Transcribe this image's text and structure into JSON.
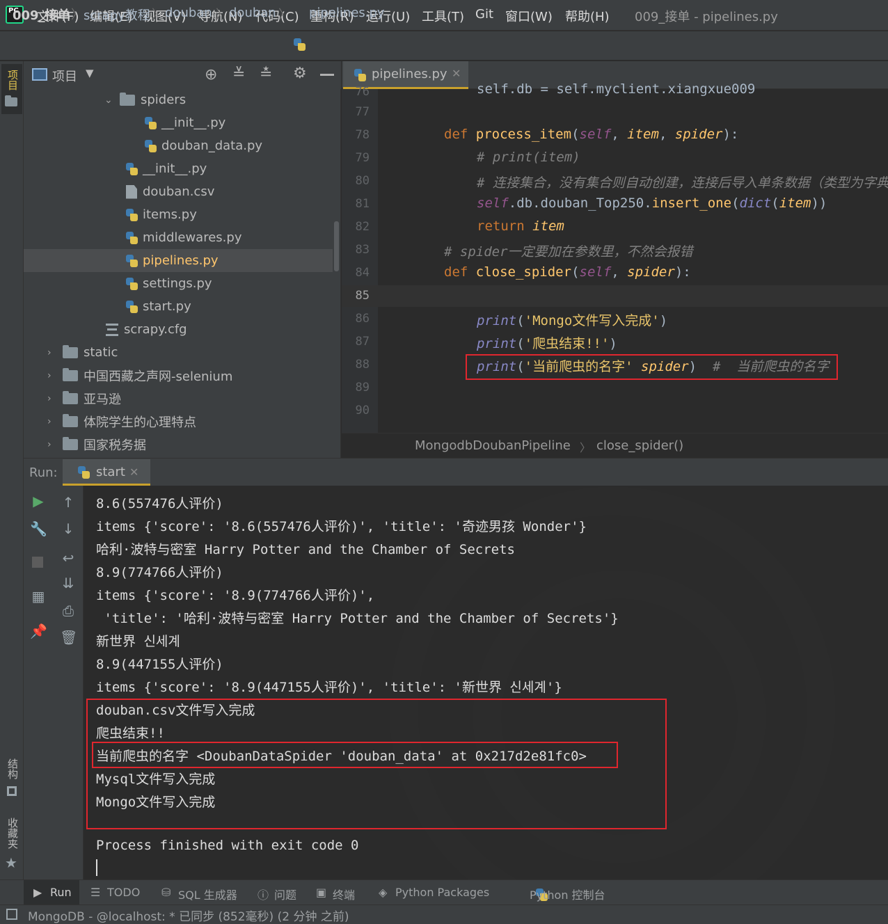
{
  "menubar": {
    "logo": "PC",
    "items": [
      "文件(F)",
      "编辑(E)",
      "视图(V)",
      "导航(N)",
      "代码(C)",
      "重构(R)",
      "运行(U)",
      "工具(T)",
      "Git",
      "窗口(W)",
      "帮助(H)"
    ],
    "window_title": "009_接单 - pipelines.py"
  },
  "breadcrumb": [
    "009_接单",
    "scrapy教程",
    "douban",
    "douban",
    "pipelines.py"
  ],
  "left_strip": {
    "project_label": "项目",
    "structure_label": "结构",
    "favorites_label": "收藏夹"
  },
  "project": {
    "title": "项目",
    "tree": [
      {
        "label": "spiders",
        "type": "folder",
        "expanded": true
      },
      {
        "label": "__init__.py",
        "type": "py"
      },
      {
        "label": "douban_data.py",
        "type": "py"
      },
      {
        "label": "__init__.py",
        "type": "py"
      },
      {
        "label": "douban.csv",
        "type": "file"
      },
      {
        "label": "items.py",
        "type": "py"
      },
      {
        "label": "middlewares.py",
        "type": "py"
      },
      {
        "label": "pipelines.py",
        "type": "py",
        "selected": true
      },
      {
        "label": "settings.py",
        "type": "py"
      },
      {
        "label": "start.py",
        "type": "py"
      },
      {
        "label": "scrapy.cfg",
        "type": "cfg"
      },
      {
        "label": "static",
        "type": "folder"
      },
      {
        "label": "中国西藏之声网-selenium",
        "type": "folder"
      },
      {
        "label": "亚马逊",
        "type": "folder"
      },
      {
        "label": "体院学生的心理特点",
        "type": "folder"
      },
      {
        "label": "国家税务据",
        "type": "folder"
      }
    ]
  },
  "editor": {
    "tab_label": "pipelines.py",
    "line_numbers": [
      "76",
      "77",
      "78",
      "79",
      "80",
      "81",
      "82",
      "83",
      "84",
      "85",
      "86",
      "87",
      "88",
      "89",
      "90"
    ],
    "code": {
      "l76": "self.db = self.myclient.xiangxue009",
      "l78_def": "def",
      "l78_name": "process_item",
      "l78_self": "self",
      "l78_item": "item",
      "l78_spider": "spider",
      "l79": "# print(item)",
      "l80": "# 连接集合，没有集合则自动创建，连接后导入单条数据（类型为字典",
      "l81_self": "self",
      "l81_mid": ".db.douban_Top250.",
      "l81_method": "insert_one",
      "l81_dict": "dict",
      "l81_item": "item",
      "l82_return": "return",
      "l82_item": "item",
      "l83": "# spider一定要加在参数里，不然会报错",
      "l84_def": "def",
      "l84_name": "close_spider",
      "l84_self": "self",
      "l84_spider": "spider",
      "l86_print": "print",
      "l86_str": "'Mongo文件写入完成'",
      "l87_print": "print",
      "l87_str": "'爬虫结束!!'",
      "l88_print": "print",
      "l88_str": "'当前爬虫的名字'",
      "l88_spider": "spider",
      "l88_cmt": "#  当前爬虫的名字"
    },
    "breadcrumb": [
      "MongodbDoubanPipeline",
      "close_spider()"
    ]
  },
  "run": {
    "label": "Run:",
    "tab": "start",
    "console": [
      "8.6(557476人评价)",
      "items {'score': '8.6(557476人评价)', 'title': '奇迹男孩 Wonder'}",
      "哈利·波特与密室 Harry Potter and the Chamber of Secrets",
      "8.9(774766人评价)",
      "items {'score': '8.9(774766人评价)',",
      " 'title': '哈利·波特与密室 Harry Potter and the Chamber of Secrets'}",
      "新世界 신세계",
      "8.9(447155人评价)",
      "items {'score': '8.9(447155人评价)', 'title': '新世界 신세계'}",
      "douban.csv文件写入完成",
      "爬虫结束!!",
      "当前爬虫的名字 <DoubanDataSpider 'douban_data' at 0x217d2e81fc0>",
      "Mysql文件写入完成",
      "Mongo文件写入完成",
      "",
      "Process finished with exit code 0"
    ]
  },
  "bottom_tabs": [
    "Run",
    "TODO",
    "SQL 生成器",
    "问题",
    "终端",
    "Python Packages",
    "Python 控制台"
  ],
  "status": "MongoDB - @localhost: * 已同步 (852毫秒) (2 分钟 之前)",
  "colors": {
    "accent": "#c9a12c",
    "highlight_box": "#e0262e",
    "background": "#2b2b2b",
    "panel": "#3c3f41"
  }
}
